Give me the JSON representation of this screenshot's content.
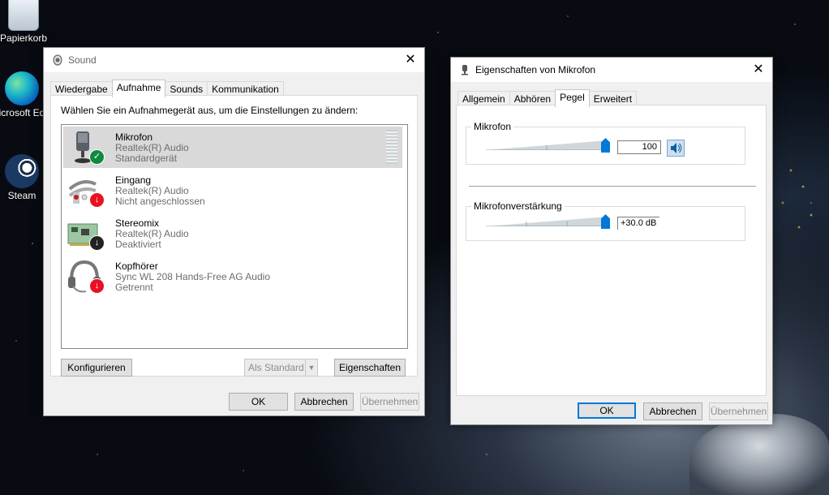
{
  "desktop": {
    "icons": [
      {
        "label": "Papierkorb"
      },
      {
        "label": "icrosoft Ed"
      },
      {
        "label": "Steam"
      }
    ]
  },
  "sound_window": {
    "title": "Sound",
    "tabs": [
      "Wiedergabe",
      "Aufnahme",
      "Sounds",
      "Kommunikation"
    ],
    "active_tab": "Aufnahme",
    "instruction": "Wählen Sie ein Aufnahmegerät aus, um die Einstellungen zu ändern:",
    "devices": [
      {
        "name": "Mikrofon",
        "driver": "Realtek(R) Audio",
        "status": "Standardgerät",
        "icon": "microphone-icon",
        "badge": "check"
      },
      {
        "name": "Eingang",
        "driver": "Realtek(R) Audio",
        "status": "Nicht angeschlossen",
        "icon": "line-in-cable-icon",
        "badge": "down-arrow"
      },
      {
        "name": "Stereomix",
        "driver": "Realtek(R) Audio",
        "status": "Deaktiviert",
        "icon": "sound-card-icon",
        "badge": "down-arrow"
      },
      {
        "name": "Kopfhörer",
        "driver": "Sync WL 208 Hands-Free AG Audio",
        "status": "Getrennt",
        "icon": "headset-icon",
        "badge": "down-arrow"
      }
    ],
    "buttons": {
      "configure": "Konfigurieren",
      "set_default": "Als Standard",
      "properties": "Eigenschaften",
      "ok": "OK",
      "cancel": "Abbrechen",
      "apply": "Übernehmen"
    }
  },
  "mic_window": {
    "title": "Eigenschaften von Mikrofon",
    "tabs": [
      "Allgemein",
      "Abhören",
      "Pegel",
      "Erweitert"
    ],
    "active_tab": "Pegel",
    "mic_group": {
      "label": "Mikrofon",
      "value": "100",
      "level": 100
    },
    "boost_group": {
      "label": "Mikrofonverstärkung",
      "value": "+30.0 dB",
      "level": 100
    },
    "buttons": {
      "ok": "OK",
      "cancel": "Abbrechen",
      "apply": "Übernehmen"
    }
  },
  "colors": {
    "accent": "#0078d7",
    "success": "#10893e",
    "error": "#e81123"
  }
}
